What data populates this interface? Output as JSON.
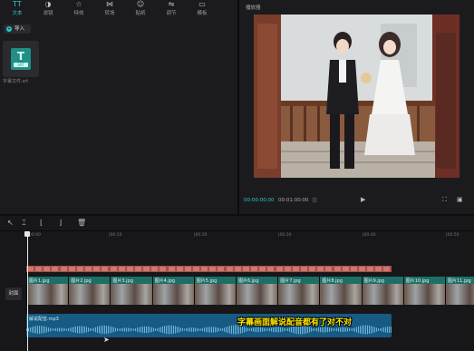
{
  "toolbar": {
    "items": [
      {
        "label": "文本",
        "icon": "text-icon"
      },
      {
        "label": "滤镜",
        "icon": "filter-icon"
      },
      {
        "label": "特效",
        "icon": "effects-icon"
      },
      {
        "label": "转场",
        "icon": "transition-icon"
      },
      {
        "label": "贴纸",
        "icon": "sticker-icon"
      },
      {
        "label": "调节",
        "icon": "adjust-icon"
      },
      {
        "label": "模板",
        "icon": "template-icon"
      }
    ]
  },
  "media": {
    "import_label": "导入",
    "file_name": "字幕文件.srt",
    "file_badge": "SRT",
    "file_glyph": "T"
  },
  "preview": {
    "title": "播放器",
    "current_time": "00:00:00:00",
    "total_time": "00:01:00:00",
    "play_glyph": "▶"
  },
  "timeline": {
    "ruler_labels": [
      "00:00",
      "|00:10",
      "|00:20",
      "|00:30",
      "|00:40",
      "|00:50"
    ],
    "cover_label": "封面",
    "video_clips": [
      "图片1.jpg",
      "图片2.jpg",
      "图片3.jpg",
      "图片4.jpg",
      "图片5.jpg",
      "图片6.jpg",
      "图片7.jpg",
      "图片8.jpg",
      "图片9.jpg",
      "图片10.jpg",
      "图片11.jpg"
    ],
    "audio_name": "解说配音.mp3"
  },
  "subtitle_text": "字幕画面解说配音都有了对不对",
  "colors": {
    "accent": "#2fc6cf",
    "text_track": "#a84e48",
    "video_head": "#1d6e66",
    "audio_track": "#175a82",
    "subtitle": "#ffe600"
  }
}
